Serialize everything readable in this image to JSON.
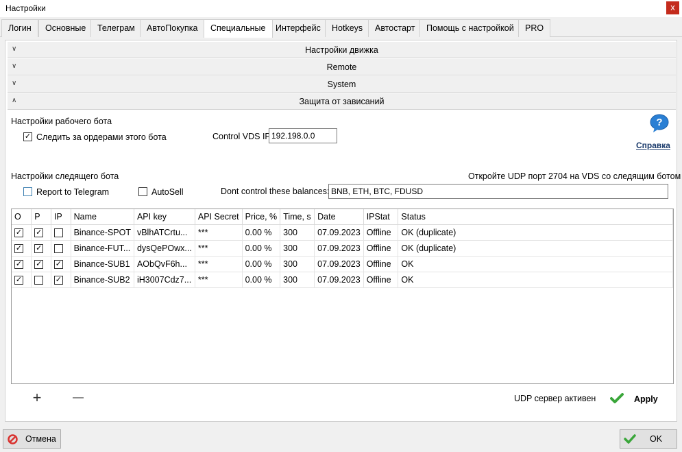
{
  "window": {
    "title": "Настройки",
    "close_glyph": "x"
  },
  "tabs": [
    {
      "label": "Логин"
    },
    {
      "label": "Основные"
    },
    {
      "label": "Телеграм"
    },
    {
      "label": "АвтоПокупка"
    },
    {
      "label": "Специальные",
      "active": true
    },
    {
      "label": "Интерфейс"
    },
    {
      "label": "Hotkeys"
    },
    {
      "label": "Автостарт"
    },
    {
      "label": "Помощь с настройкой"
    },
    {
      "label": "PRO"
    }
  ],
  "accordion": [
    {
      "label": "Настройки движка",
      "expanded": false
    },
    {
      "label": "Remote",
      "expanded": false
    },
    {
      "label": "System",
      "expanded": false
    },
    {
      "label": "Защита от зависаний",
      "expanded": true
    }
  ],
  "worker_bot": {
    "section_title": "Настройки рабочего бота",
    "watch_orders_label": "Следить за ордерами этого бота",
    "watch_orders_checked": true,
    "vds_ip_label": "Control VDS IP",
    "vds_ip_value": "192.198.0.0"
  },
  "help": {
    "link_text": "Справка",
    "icon": "question-bubble-icon"
  },
  "follower_bot": {
    "section_title": "Настройки следящего бота",
    "udp_hint": "Откройте UDP порт 2704 на VDS со следящим ботом",
    "report_telegram_label": "Report to Telegram",
    "report_telegram_checked": false,
    "autosell_label": "AutoSell",
    "autosell_checked": false,
    "dont_control_label": "Dont control these balances:",
    "dont_control_value": "BNB, ETH, BTC, FDUSD"
  },
  "grid": {
    "columns": [
      "O",
      "P",
      "IP",
      "Name",
      "API key",
      "API Secret",
      "Price, %",
      "Time, s",
      "Date",
      "IPStat",
      "Status"
    ],
    "rows": [
      {
        "o": true,
        "p": true,
        "ip": false,
        "name": "Binance-SPOT",
        "api_key": "vBlhATCrtu...",
        "api_secret": "***",
        "price": "0.00 %",
        "time": "300",
        "date": "07.09.2023",
        "ipstat": "Offline",
        "status": "OK (duplicate)"
      },
      {
        "o": true,
        "p": true,
        "ip": false,
        "name": "Binance-FUT...",
        "api_key": "dysQePOwx...",
        "api_secret": "***",
        "price": "0.00 %",
        "time": "300",
        "date": "07.09.2023",
        "ipstat": "Offline",
        "status": "OK (duplicate)"
      },
      {
        "o": true,
        "p": true,
        "ip": true,
        "name": "Binance-SUB1",
        "api_key": "AObQvF6h...",
        "api_secret": "***",
        "price": "0.00 %",
        "time": "300",
        "date": "07.09.2023",
        "ipstat": "Offline",
        "status": "OK"
      },
      {
        "o": true,
        "p": false,
        "ip": true,
        "name": "Binance-SUB2",
        "api_key": "iH3007Cdz7...",
        "api_secret": "***",
        "price": "0.00 %",
        "time": "300",
        "date": "07.09.2023",
        "ipstat": "Offline",
        "status": "OK"
      }
    ]
  },
  "bottom": {
    "add_glyph": "+",
    "remove_glyph": "—",
    "udp_status": "UDP сервер активен",
    "apply_label": "Apply"
  },
  "footer": {
    "cancel_label": "Отмена",
    "ok_label": "OK"
  },
  "colors": {
    "check_green": "#3aa63a",
    "cancel_red": "#d9322f",
    "help_blue": "#2a7fd4",
    "link": "#1a3a6b"
  }
}
